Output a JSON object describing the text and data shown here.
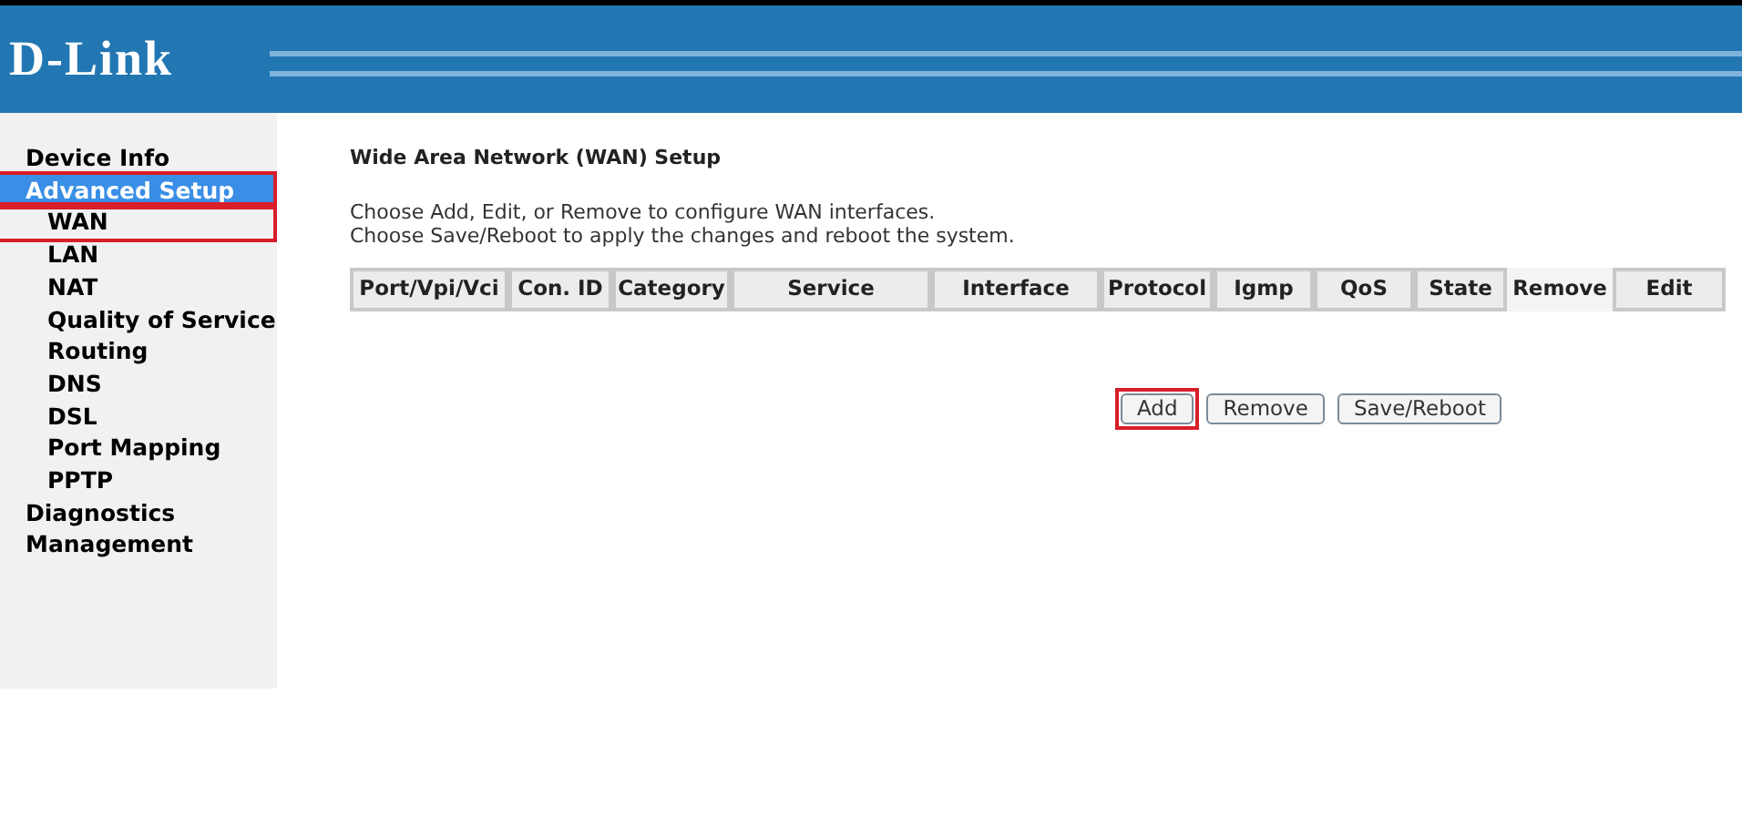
{
  "header": {
    "logo": "D-Link"
  },
  "sidebar": {
    "items": [
      {
        "label": "Device Info",
        "selected": false,
        "highlighted": false
      },
      {
        "label": "Advanced Setup",
        "selected": true,
        "highlighted": true,
        "children": [
          {
            "label": "WAN",
            "selected": false,
            "highlighted": true
          },
          {
            "label": "LAN",
            "selected": false,
            "highlighted": false
          },
          {
            "label": "NAT",
            "selected": false,
            "highlighted": false
          },
          {
            "label": "Quality of Service",
            "selected": false,
            "highlighted": false
          },
          {
            "label": "Routing",
            "selected": false,
            "highlighted": false
          },
          {
            "label": "DNS",
            "selected": false,
            "highlighted": false
          },
          {
            "label": "DSL",
            "selected": false,
            "highlighted": false
          },
          {
            "label": "Port Mapping",
            "selected": false,
            "highlighted": false
          },
          {
            "label": "PPTP",
            "selected": false,
            "highlighted": false
          }
        ]
      },
      {
        "label": "Diagnostics",
        "selected": false,
        "highlighted": false
      },
      {
        "label": "Management",
        "selected": false,
        "highlighted": false
      }
    ]
  },
  "main": {
    "title": "Wide Area Network (WAN) Setup",
    "description": [
      "Choose Add, Edit, or Remove to configure WAN interfaces.",
      "Choose Save/Reboot to apply the changes and reboot the system."
    ],
    "table": {
      "columns": [
        {
          "label": "Port/Vpi/Vci",
          "kind": "boxed"
        },
        {
          "label": "Con. ID",
          "kind": "boxed"
        },
        {
          "label": "Category",
          "kind": "boxed"
        },
        {
          "label": "Service",
          "kind": "boxed"
        },
        {
          "label": "Interface",
          "kind": "boxed"
        },
        {
          "label": "Protocol",
          "kind": "boxed"
        },
        {
          "label": "Igmp",
          "kind": "boxed"
        },
        {
          "label": "QoS",
          "kind": "boxed"
        },
        {
          "label": "State",
          "kind": "boxed"
        },
        {
          "label": "Remove",
          "kind": "plain"
        },
        {
          "label": "Edit",
          "kind": "boxed"
        }
      ]
    },
    "buttons": [
      {
        "label": "Add",
        "highlighted": true
      },
      {
        "label": "Remove",
        "highlighted": false
      },
      {
        "label": "Save/Reboot",
        "highlighted": false
      }
    ]
  }
}
